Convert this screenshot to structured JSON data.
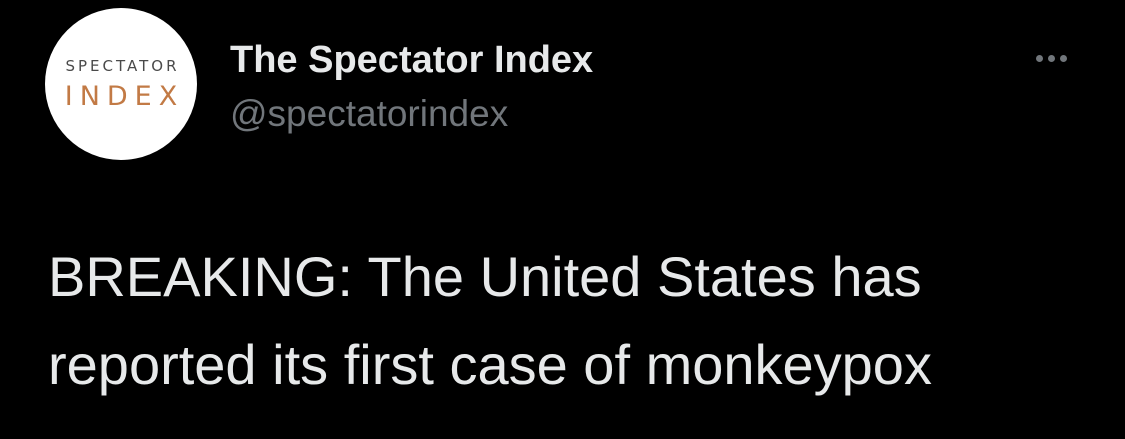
{
  "tweet": {
    "avatar": {
      "line1": "SPECTATOR",
      "line2": "INDEX",
      "colors": {
        "background": "#ffffff",
        "line1": "#4a4a4a",
        "line2": "#c27a45"
      }
    },
    "author": {
      "display_name": "The Spectator Index",
      "handle": "@spectatorindex"
    },
    "more_icon": "more-horizontal-icon",
    "text_line1": "BREAKING: The United States has",
    "text_line2": "reported its first case of monkeypox"
  },
  "theme": {
    "background": "#000000",
    "primary_text": "#e7e9ea",
    "secondary_text": "#71767b"
  }
}
